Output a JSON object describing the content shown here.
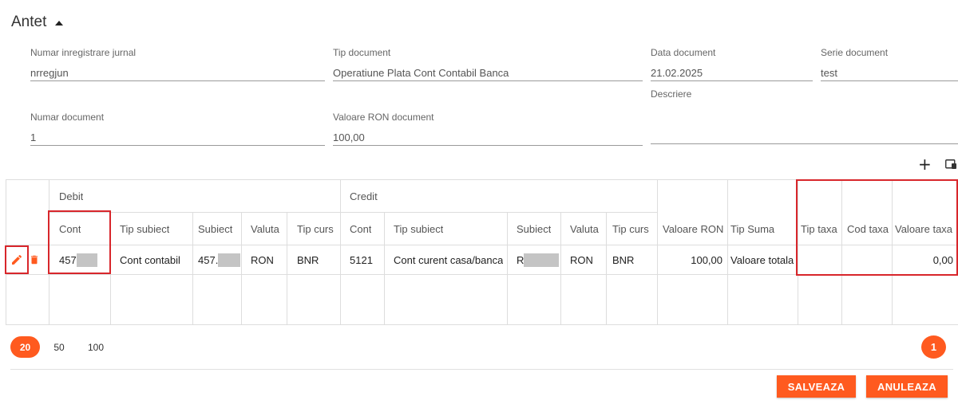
{
  "section": {
    "title": "Antet"
  },
  "form": {
    "numar_inregistrare": {
      "label": "Numar inregistrare jurnal",
      "value": "nrregjun"
    },
    "tip_document": {
      "label": "Tip document",
      "value": "Operatiune Plata Cont Contabil Banca"
    },
    "data_document": {
      "label": "Data document",
      "value": "21.02.2025"
    },
    "serie_document": {
      "label": "Serie document",
      "value": "test"
    },
    "numar_document": {
      "label": "Numar document",
      "value": "1"
    },
    "valoare_ron": {
      "label": "Valoare RON document",
      "value": "100,00"
    },
    "descriere": {
      "label": "Descriere",
      "value": ""
    }
  },
  "grid": {
    "groups": {
      "debit": "Debit",
      "credit": "Credit"
    },
    "columns": {
      "debit_cont": "Cont",
      "debit_tip_subiect": "Tip subiect",
      "debit_subiect": "Subiect",
      "debit_valuta": "Valuta",
      "debit_tip_curs": "Tip curs",
      "credit_cont": "Cont",
      "credit_tip_subiect": "Tip subiect",
      "credit_subiect": "Subiect",
      "credit_valuta": "Valuta",
      "credit_tip_curs": "Tip curs",
      "valoare_ron": "Valoare RON",
      "tip_suma": "Tip Suma",
      "tip_taxa": "Tip taxa",
      "cod_taxa": "Cod taxa",
      "valoare_taxa": "Valoare taxa"
    },
    "row": {
      "debit_cont": "457",
      "debit_tip_subiect": "Cont contabil",
      "debit_subiect": "457.",
      "debit_valuta": "RON",
      "debit_tip_curs": "BNR",
      "credit_cont": "5121",
      "credit_tip_subiect": "Cont curent casa/banca",
      "credit_subiect": "R",
      "credit_valuta": "RON",
      "credit_tip_curs": "BNR",
      "valoare_ron": "100,00",
      "tip_suma": "Valoare totala",
      "tip_taxa": "",
      "cod_taxa": "",
      "valoare_taxa": "0,00"
    }
  },
  "pagination": {
    "sizes": [
      "20",
      "50",
      "100"
    ],
    "active_size": "20",
    "current_page": "1"
  },
  "actions": {
    "save": "SALVEAZA",
    "cancel": "ANULEAZA"
  },
  "colors": {
    "accent": "#ff5a1f",
    "highlight": "#d8262b"
  }
}
